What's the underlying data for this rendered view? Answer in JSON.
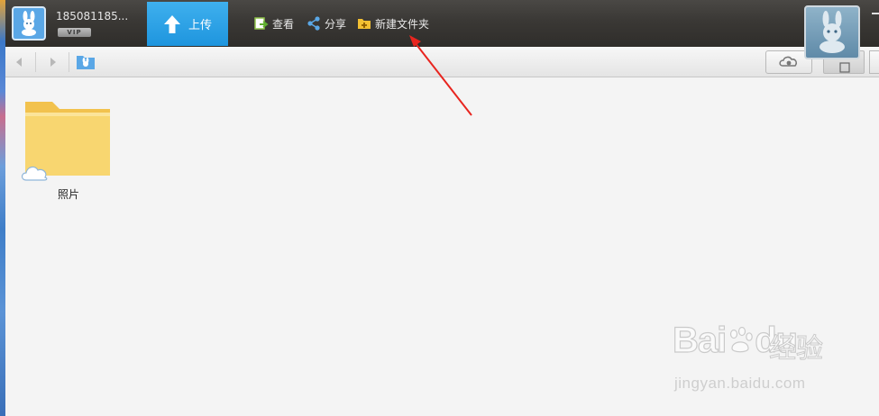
{
  "window": {
    "username": "185081185...",
    "vip_badge": "VIP"
  },
  "toolbar": {
    "upload_label": "上传",
    "view_label": "查看",
    "share_label": "分享",
    "new_folder_label": "新建文件夹"
  },
  "files": [
    {
      "name": "照片",
      "type": "folder",
      "cloud": true
    }
  ],
  "watermark": {
    "brand": "Bai",
    "brand_suffix": "du",
    "product": "经验",
    "url": "jingyan.baidu.com"
  },
  "colors": {
    "topbar": "#3a3835",
    "upload_button": "#1e95de",
    "annotation_arrow": "#e8251f",
    "folder": "#f7cf5c"
  },
  "icons": {
    "view": "view-icon",
    "share": "share-icon",
    "new_folder": "new-folder-icon",
    "cloud": "cloud-icon",
    "eye": "eye-icon"
  }
}
